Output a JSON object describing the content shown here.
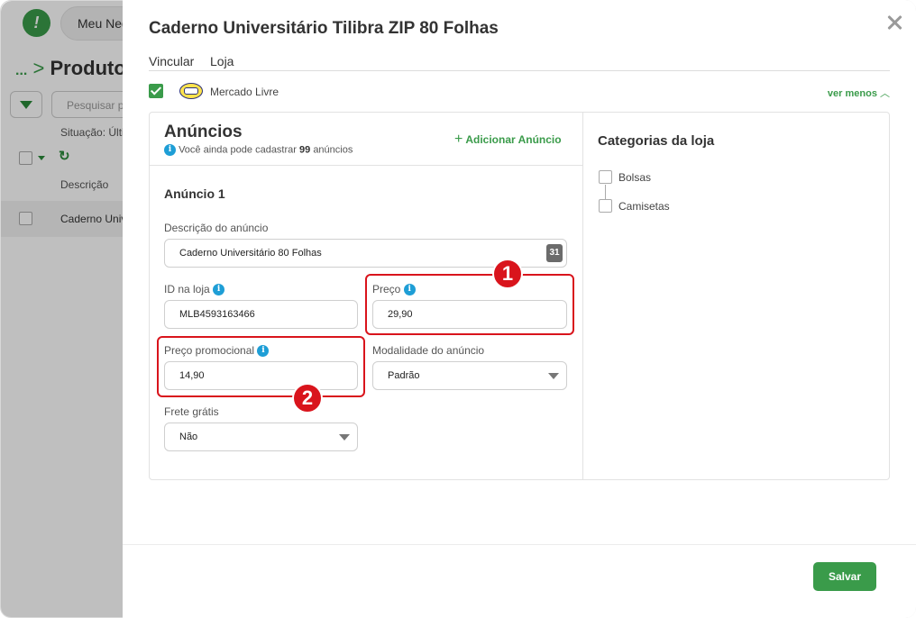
{
  "background": {
    "topbar": {
      "menu_label": "Meu Neg"
    },
    "page_title": {
      "dots": "...",
      "text": "Produto"
    },
    "search": {
      "placeholder": "Pesquisar p"
    },
    "status_text": "Situação: Últi",
    "column_header": "Descrição",
    "row": {
      "description": "Caderno Univ"
    }
  },
  "modal": {
    "title": "Caderno Universitário Tilibra ZIP 80 Folhas",
    "tabs": [
      "Vincular",
      "Loja"
    ],
    "store": {
      "name": "Mercado Livre",
      "checked": true,
      "toggle_label": "ver menos"
    },
    "anuncios": {
      "title": "Anúncios",
      "subtitle_prefix": "Você ainda pode cadastrar",
      "remaining_count": "99",
      "subtitle_suffix": "anúncios",
      "add_label": "Adicionar Anúncio"
    },
    "anuncio": {
      "title": "Anúncio 1",
      "descricao": {
        "label": "Descrição do anúncio",
        "value": "Caderno Universitário 80 Folhas",
        "counter": "31"
      },
      "id_loja": {
        "label": "ID na loja",
        "value": "MLB4593163466"
      },
      "preco": {
        "label": "Preço",
        "value": "29,90"
      },
      "preco_promocional": {
        "label": "Preço promocional",
        "value": "14,90"
      },
      "modalidade": {
        "label": "Modalidade do anúncio",
        "value": "Padrão"
      },
      "frete": {
        "label": "Frete grátis",
        "value": "Não"
      }
    },
    "categorias": {
      "title": "Categorias da loja",
      "items": [
        {
          "label": "Bolsas",
          "checked": false
        },
        {
          "label": "Camisetas",
          "checked": false
        }
      ]
    },
    "annotations": [
      "1",
      "2"
    ],
    "save_label": "Salvar"
  },
  "colors": {
    "accent_green": "#3a9b4a",
    "highlight_red": "#d9141c",
    "info_blue": "#1e9ed6"
  }
}
